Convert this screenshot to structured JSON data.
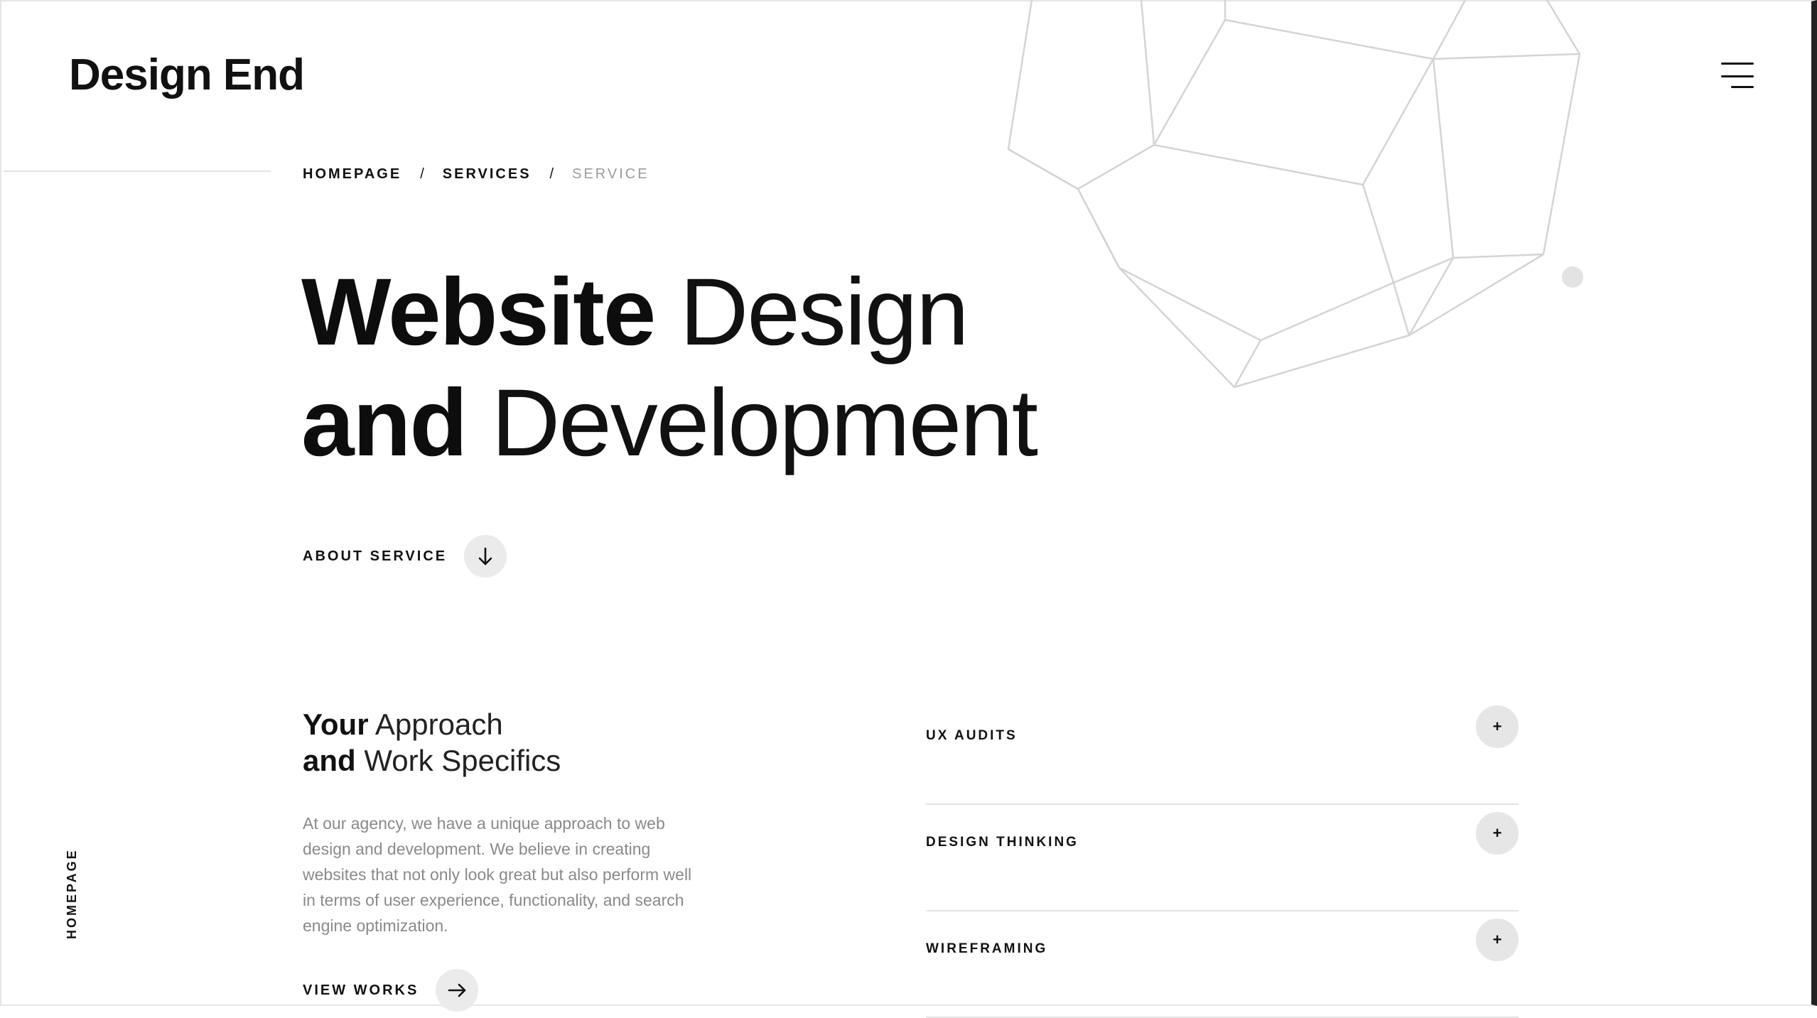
{
  "brand": {
    "logo": "Design End"
  },
  "header": {
    "menu_icon": "hamburger-menu-icon"
  },
  "breadcrumb": {
    "items": [
      "Homepage",
      "Services",
      "Service"
    ],
    "separator": "/"
  },
  "hero": {
    "line1_bold": "Website",
    "line1_thin": "Design",
    "line2_bold": "and",
    "line2_thin": "Development",
    "cta_label": "About Service",
    "cta_icon": "arrow-down-icon"
  },
  "approach": {
    "title_line1_bold": "Your",
    "title_line1_thin": "Approach",
    "title_line2_bold": "and",
    "title_line2_thin": "Work Specifics",
    "text": "At our agency, we have a unique approach to web design and development. We believe in creating websites that not only look great but also perform well in terms of user experience, functionality, and search engine optimization.",
    "cta_label": "View Works",
    "cta_icon": "arrow-right-icon"
  },
  "accordion": {
    "items": [
      {
        "label": "UX Audits",
        "toggle": "+"
      },
      {
        "label": "Design Thinking",
        "toggle": "+"
      },
      {
        "label": "Wireframing",
        "toggle": "+"
      }
    ]
  },
  "side": {
    "vertical_label": "Homepage"
  },
  "colors": {
    "accent_circle": "#ebebeb",
    "text": "#111111",
    "muted": "#8a8a8a",
    "rule": "#e3e3e3"
  }
}
